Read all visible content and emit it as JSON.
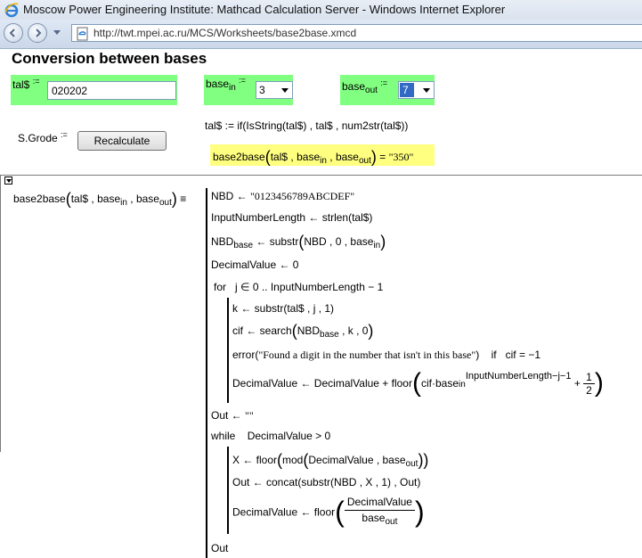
{
  "window": {
    "title": "Moscow Power Engineering Institute: Mathcad Calculation Server - Windows Internet Explorer"
  },
  "addressbar": {
    "url": "http://twt.mpei.ac.ru/MCS/Worksheets/base2base.xmcd"
  },
  "worksheet": {
    "title": "Conversion between bases",
    "tal_input": {
      "label": "tal$",
      "assign": ":=",
      "value": "020202"
    },
    "base_in": {
      "label": "base",
      "sub": "in",
      "assign": ":=",
      "value": "3"
    },
    "base_out": {
      "label": "base",
      "sub": "out",
      "assign": ":=",
      "value": "7"
    },
    "author": {
      "label": "S.Grode",
      "assign": ":="
    },
    "recalculate_label": "Recalculate",
    "tal_redef": "tal$ := if(IsString(tal$) , tal$ , num2str(tal$))",
    "result": {
      "fn": "base2base",
      "arg1": "tal$",
      "arg2": "base",
      "arg2_sub": "in",
      "arg3": "base",
      "arg3_sub": "out",
      "equals": "=",
      "value": "\"350\""
    },
    "program": {
      "def_fn": "base2base",
      "def_arg1": "tal$",
      "def_arg2": "base",
      "def_arg2_sub": "in",
      "def_arg3": "base",
      "def_arg3_sub": "out",
      "def_equiv": "≡",
      "nbd_lhs": "NBD ←",
      "nbd_rhs": "\"0123456789ABCDEF\"",
      "inlen": "InputNumberLength ← strlen(tal$)",
      "nbdbase_lhs": "NBD",
      "nbdbase_sub": "base",
      "nbdbase_rhs": "← substr",
      "nbdbase_args": "NBD , 0 , base",
      "nbdbase_args_sub": "in",
      "dec_init": "DecimalValue ← 0",
      "for_kw": "for",
      "for_range": "j ∈ 0 .. InputNumberLength − 1",
      "k_line": "k ← substr(tal$ , j , 1)",
      "cif_lhs": "cif ← search",
      "cif_a": "NBD",
      "cif_a_sub": "base",
      "cif_b": ", k , 0",
      "error_fn": "error(",
      "error_msg": "\"Found a digit in the number that isn't in this base\"",
      "error_tail": ")",
      "if_kw": "if",
      "if_cond": "cif = −1",
      "dv_update_lhs": "DecimalValue ← DecimalValue + floor",
      "dv_cif": "cif·base",
      "dv_cif_sub": "in",
      "dv_exp": "InputNumberLength−j−1",
      "dv_plus": "+",
      "dv_half_num": "1",
      "dv_half_den": "2",
      "out_init_lhs": "Out ←",
      "out_init_rhs": "\"\"",
      "while_kw": "while",
      "while_cond": "DecimalValue > 0",
      "x_lhs": "X ← floor",
      "x_mod": "mod",
      "x_args": "DecimalValue , base",
      "x_args_sub": "out",
      "out_line": "Out ← concat(substr(NBD , X , 1) , Out)",
      "dv_div_lhs": "DecimalValue ← floor",
      "dv_div_num": "DecimalValue",
      "dv_div_den": "base",
      "dv_div_den_sub": "out",
      "ret": "Out"
    }
  }
}
